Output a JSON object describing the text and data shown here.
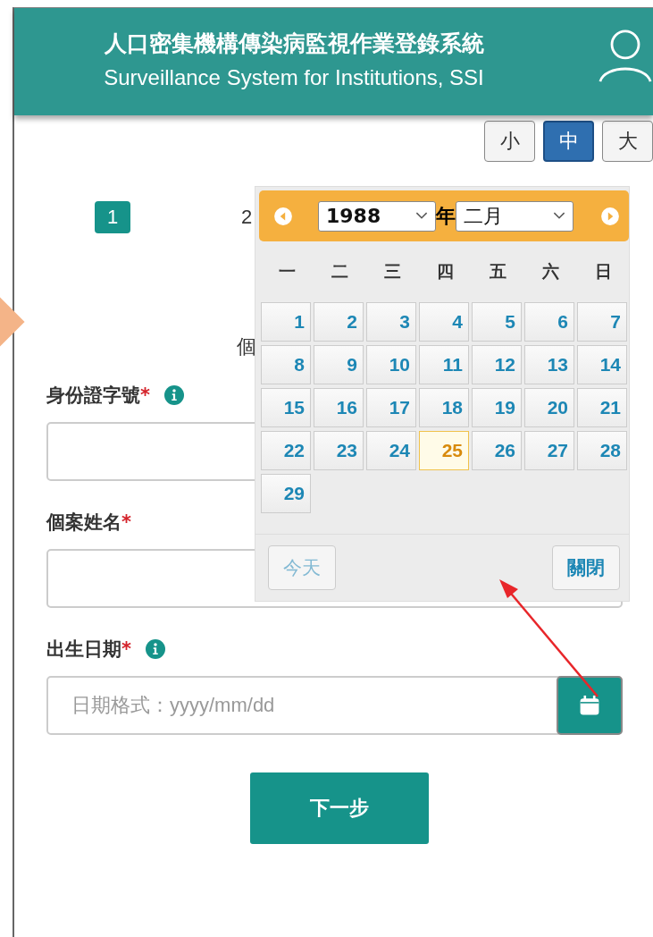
{
  "header": {
    "title": "人口密集機構傳染病監視作業登錄系統",
    "subtitle": "Surveillance System for Institutions, SSI"
  },
  "font_sizes": [
    {
      "label": "小",
      "selected": false
    },
    {
      "label": "中",
      "selected": true
    },
    {
      "label": "大",
      "selected": false
    }
  ],
  "steps": [
    {
      "label": "1",
      "selected": true
    },
    {
      "label": "2",
      "selected": false
    }
  ],
  "section_title": "個",
  "fields": [
    {
      "kind": "text",
      "label": "身份證字號",
      "required_mark": "*",
      "info": true
    },
    {
      "kind": "text",
      "label": "個案姓名",
      "required_mark": "*",
      "info": false
    },
    {
      "kind": "date",
      "label": "出生日期",
      "required_mark": "*",
      "info": true,
      "placeholder": "日期格式：yyyy/mm/dd"
    }
  ],
  "next_button": "下一步",
  "datepicker": {
    "year": "1988",
    "year_suffix": "年",
    "month": "二月",
    "weekdays": [
      "一",
      "二",
      "三",
      "四",
      "五",
      "六",
      "日"
    ],
    "days": [
      {
        "label": "1",
        "selected": false
      },
      {
        "label": "2",
        "selected": false
      },
      {
        "label": "3",
        "selected": false
      },
      {
        "label": "4",
        "selected": false
      },
      {
        "label": "5",
        "selected": false
      },
      {
        "label": "6",
        "selected": false
      },
      {
        "label": "7",
        "selected": false
      },
      {
        "label": "8",
        "selected": false
      },
      {
        "label": "9",
        "selected": false
      },
      {
        "label": "10",
        "selected": false
      },
      {
        "label": "11",
        "selected": false
      },
      {
        "label": "12",
        "selected": false
      },
      {
        "label": "13",
        "selected": false
      },
      {
        "label": "14",
        "selected": false
      },
      {
        "label": "15",
        "selected": false
      },
      {
        "label": "16",
        "selected": false
      },
      {
        "label": "17",
        "selected": false
      },
      {
        "label": "18",
        "selected": false
      },
      {
        "label": "19",
        "selected": false
      },
      {
        "label": "20",
        "selected": false
      },
      {
        "label": "21",
        "selected": false
      },
      {
        "label": "22",
        "selected": false
      },
      {
        "label": "23",
        "selected": false
      },
      {
        "label": "24",
        "selected": false
      },
      {
        "label": "25",
        "selected": true
      },
      {
        "label": "26",
        "selected": false
      },
      {
        "label": "27",
        "selected": false
      },
      {
        "label": "28",
        "selected": false
      },
      {
        "label": "29",
        "selected": false
      }
    ],
    "today_button": "今天",
    "close_button": "關閉"
  }
}
